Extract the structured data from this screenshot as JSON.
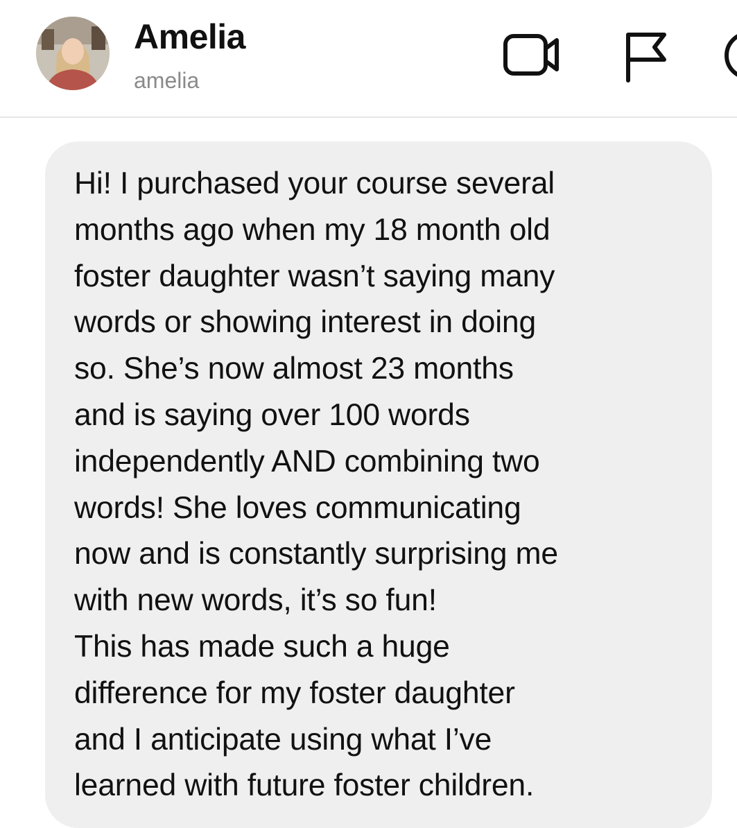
{
  "header": {
    "name": "Amelia",
    "handle": "amelia",
    "avatar_icon": "avatar-photo",
    "actions": [
      {
        "icon": "video-camera-icon"
      },
      {
        "icon": "flag-icon"
      },
      {
        "icon": "info-icon"
      }
    ]
  },
  "message": {
    "lines": [
      "Hi! I purchased your course several",
      "months ago when my 18 month old",
      "foster daughter wasn’t saying many",
      "words or showing interest in doing",
      "so. She’s now almost 23 months",
      "and is saying over 100 words",
      "independently AND combining two",
      "words! She loves communicating",
      "now and is constantly surprising me",
      "with new words, it’s so fun!",
      "This has made such a huge",
      "difference for my foster daughter",
      "and I anticipate using what I’ve",
      "learned with future foster children."
    ]
  },
  "colors": {
    "bubble": "#efefef",
    "text": "#111111",
    "handle": "#8a8a8a",
    "divider": "#e6e6e6"
  }
}
